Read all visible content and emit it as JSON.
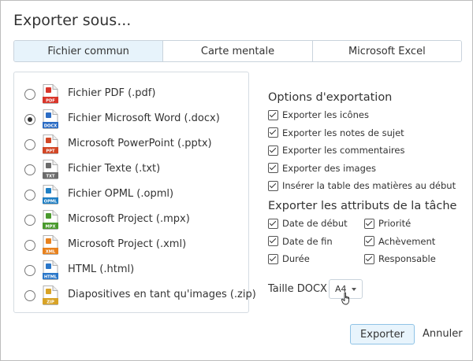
{
  "dialog": {
    "title": "Exporter sous..."
  },
  "tabs": [
    {
      "label": "Fichier commun",
      "active": true
    },
    {
      "label": "Carte mentale",
      "active": false
    },
    {
      "label": "Microsoft Excel",
      "active": false
    }
  ],
  "formats": [
    {
      "label": "Fichier PDF (.pdf)",
      "icon_text": "PDF",
      "icon": "pdf-icon",
      "color": "#d9362b",
      "selected": false
    },
    {
      "label": "Fichier Microsoft Word (.docx)",
      "icon_text": "DOCX",
      "icon": "word-icon",
      "color": "#2b6cc4",
      "selected": true
    },
    {
      "label": "Microsoft PowerPoint (.pptx)",
      "icon_text": "PPT",
      "icon": "powerpoint-icon",
      "color": "#d24726",
      "selected": false
    },
    {
      "label": "Fichier Texte (.txt)",
      "icon_text": "TXT",
      "icon": "text-file-icon",
      "color": "#6b6b6b",
      "selected": false
    },
    {
      "label": "Fichier OPML (.opml)",
      "icon_text": "OPML",
      "icon": "opml-icon",
      "color": "#1f7fc4",
      "selected": false
    },
    {
      "label": "Microsoft Project (.mpx)",
      "icon_text": "MPX",
      "icon": "project-mpx-icon",
      "color": "#4a9a2e",
      "selected": false
    },
    {
      "label": "Microsoft Project (.xml)",
      "icon_text": "XML",
      "icon": "xml-icon",
      "color": "#e8821e",
      "selected": false
    },
    {
      "label": "HTML (.html)",
      "icon_text": "HTML",
      "icon": "html-icon",
      "color": "#2a77c9",
      "selected": false
    },
    {
      "label": "Diapositives en tant qu'images (.zip)",
      "icon_text": "ZIP",
      "icon": "zip-icon",
      "color": "#d8a326",
      "selected": false
    }
  ],
  "options": {
    "title": "Options d'exportation",
    "items": [
      {
        "label": "Exporter les icônes",
        "checked": true
      },
      {
        "label": "Exporter les notes de sujet",
        "checked": true
      },
      {
        "label": "Exporter les commentaires",
        "checked": true
      },
      {
        "label": "Exporter des images",
        "checked": true
      },
      {
        "label": "Insérer la table des matières au début",
        "checked": true
      }
    ]
  },
  "attributes": {
    "title": "Exporter les attributs de la tâche",
    "items": [
      {
        "label": "Date de début",
        "checked": true
      },
      {
        "label": "Priorité",
        "checked": true
      },
      {
        "label": "Date de fin",
        "checked": true
      },
      {
        "label": "Achèvement",
        "checked": true
      },
      {
        "label": "Durée",
        "checked": true
      },
      {
        "label": "Responsable",
        "checked": true
      }
    ]
  },
  "docx_size": {
    "label": "Taille DOCX",
    "value": "A4"
  },
  "buttons": {
    "export": "Exporter",
    "cancel": "Annuler"
  },
  "colors": {
    "accent_border": "#8fc3e6",
    "accent_bg": "#e8f4fc",
    "tab_active_bg": "#e7f3fb"
  }
}
